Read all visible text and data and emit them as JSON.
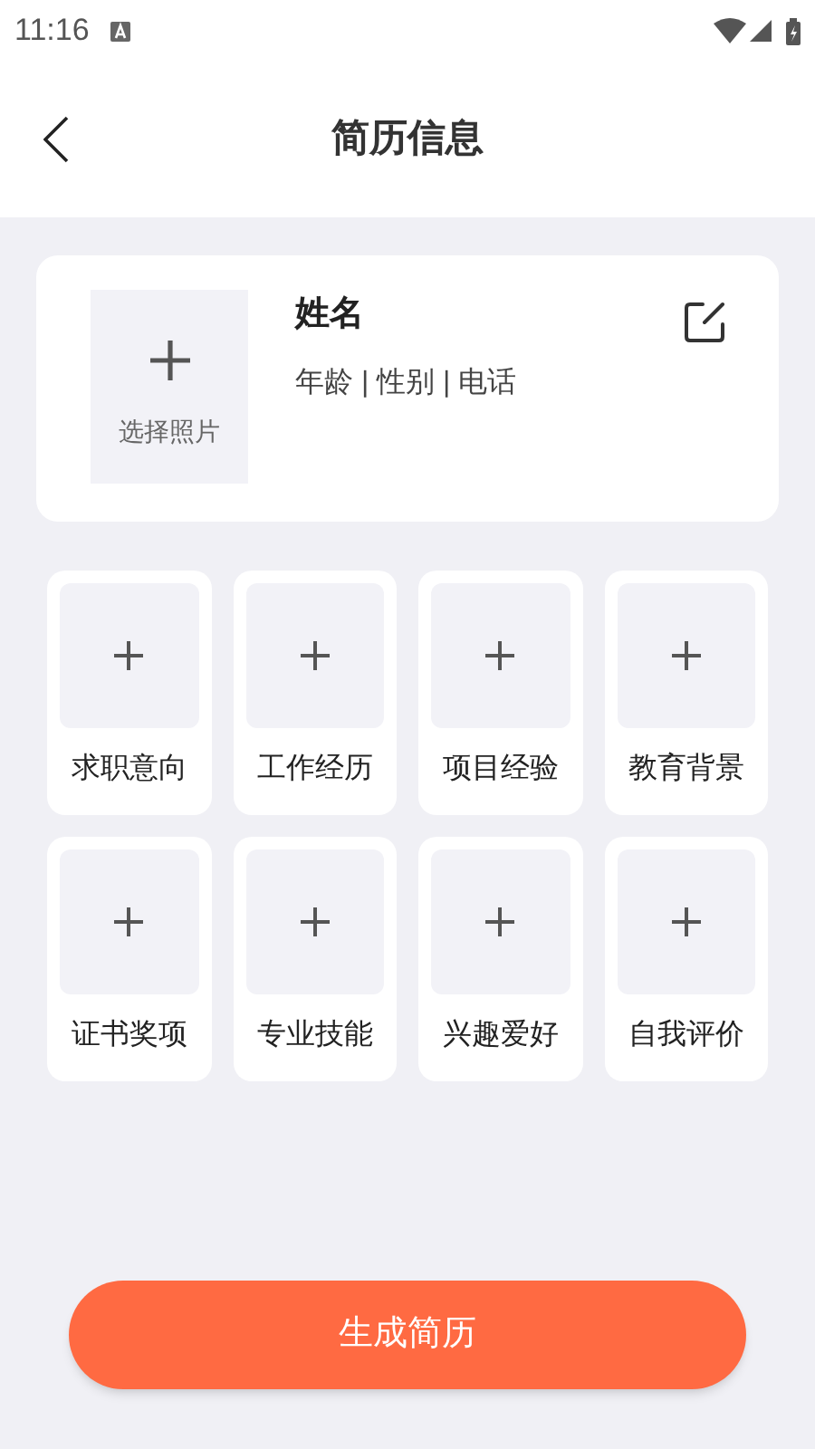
{
  "status_bar": {
    "time": "11:16"
  },
  "header": {
    "title": "简历信息"
  },
  "profile": {
    "photo_label": "选择照片",
    "name": "姓名",
    "details": "年龄 | 性别 | 电话"
  },
  "sections": [
    {
      "label": "求职意向"
    },
    {
      "label": "工作经历"
    },
    {
      "label": "项目经验"
    },
    {
      "label": "教育背景"
    },
    {
      "label": "证书奖项"
    },
    {
      "label": "专业技能"
    },
    {
      "label": "兴趣爱好"
    },
    {
      "label": "自我评价"
    }
  ],
  "primary_button": {
    "label": "生成简历"
  }
}
